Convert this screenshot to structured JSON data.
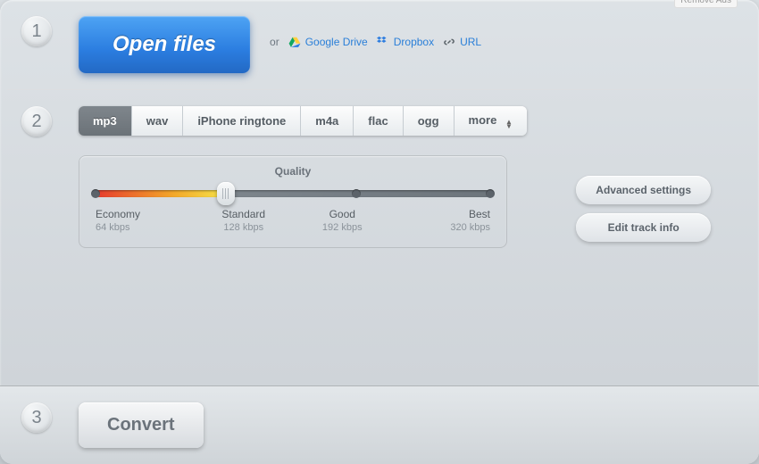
{
  "top": {
    "remove_ads": "Remove Ads"
  },
  "step1": {
    "number": "1",
    "open_files": "Open files",
    "or": "or",
    "google_drive": "Google Drive",
    "dropbox": "Dropbox",
    "url": "URL"
  },
  "step2": {
    "number": "2",
    "formats": [
      "mp3",
      "wav",
      "iPhone ringtone",
      "m4a",
      "flac",
      "ogg",
      "more"
    ],
    "active_format_index": 0,
    "quality_label": "Quality",
    "quality_stops": [
      {
        "name": "Economy",
        "rate": "64 kbps"
      },
      {
        "name": "Standard",
        "rate": "128 kbps"
      },
      {
        "name": "Good",
        "rate": "192 kbps"
      },
      {
        "name": "Best",
        "rate": "320 kbps"
      }
    ],
    "selected_quality_index": 1,
    "advanced_settings": "Advanced settings",
    "edit_track_info": "Edit track info"
  },
  "step3": {
    "number": "3",
    "convert": "Convert"
  }
}
